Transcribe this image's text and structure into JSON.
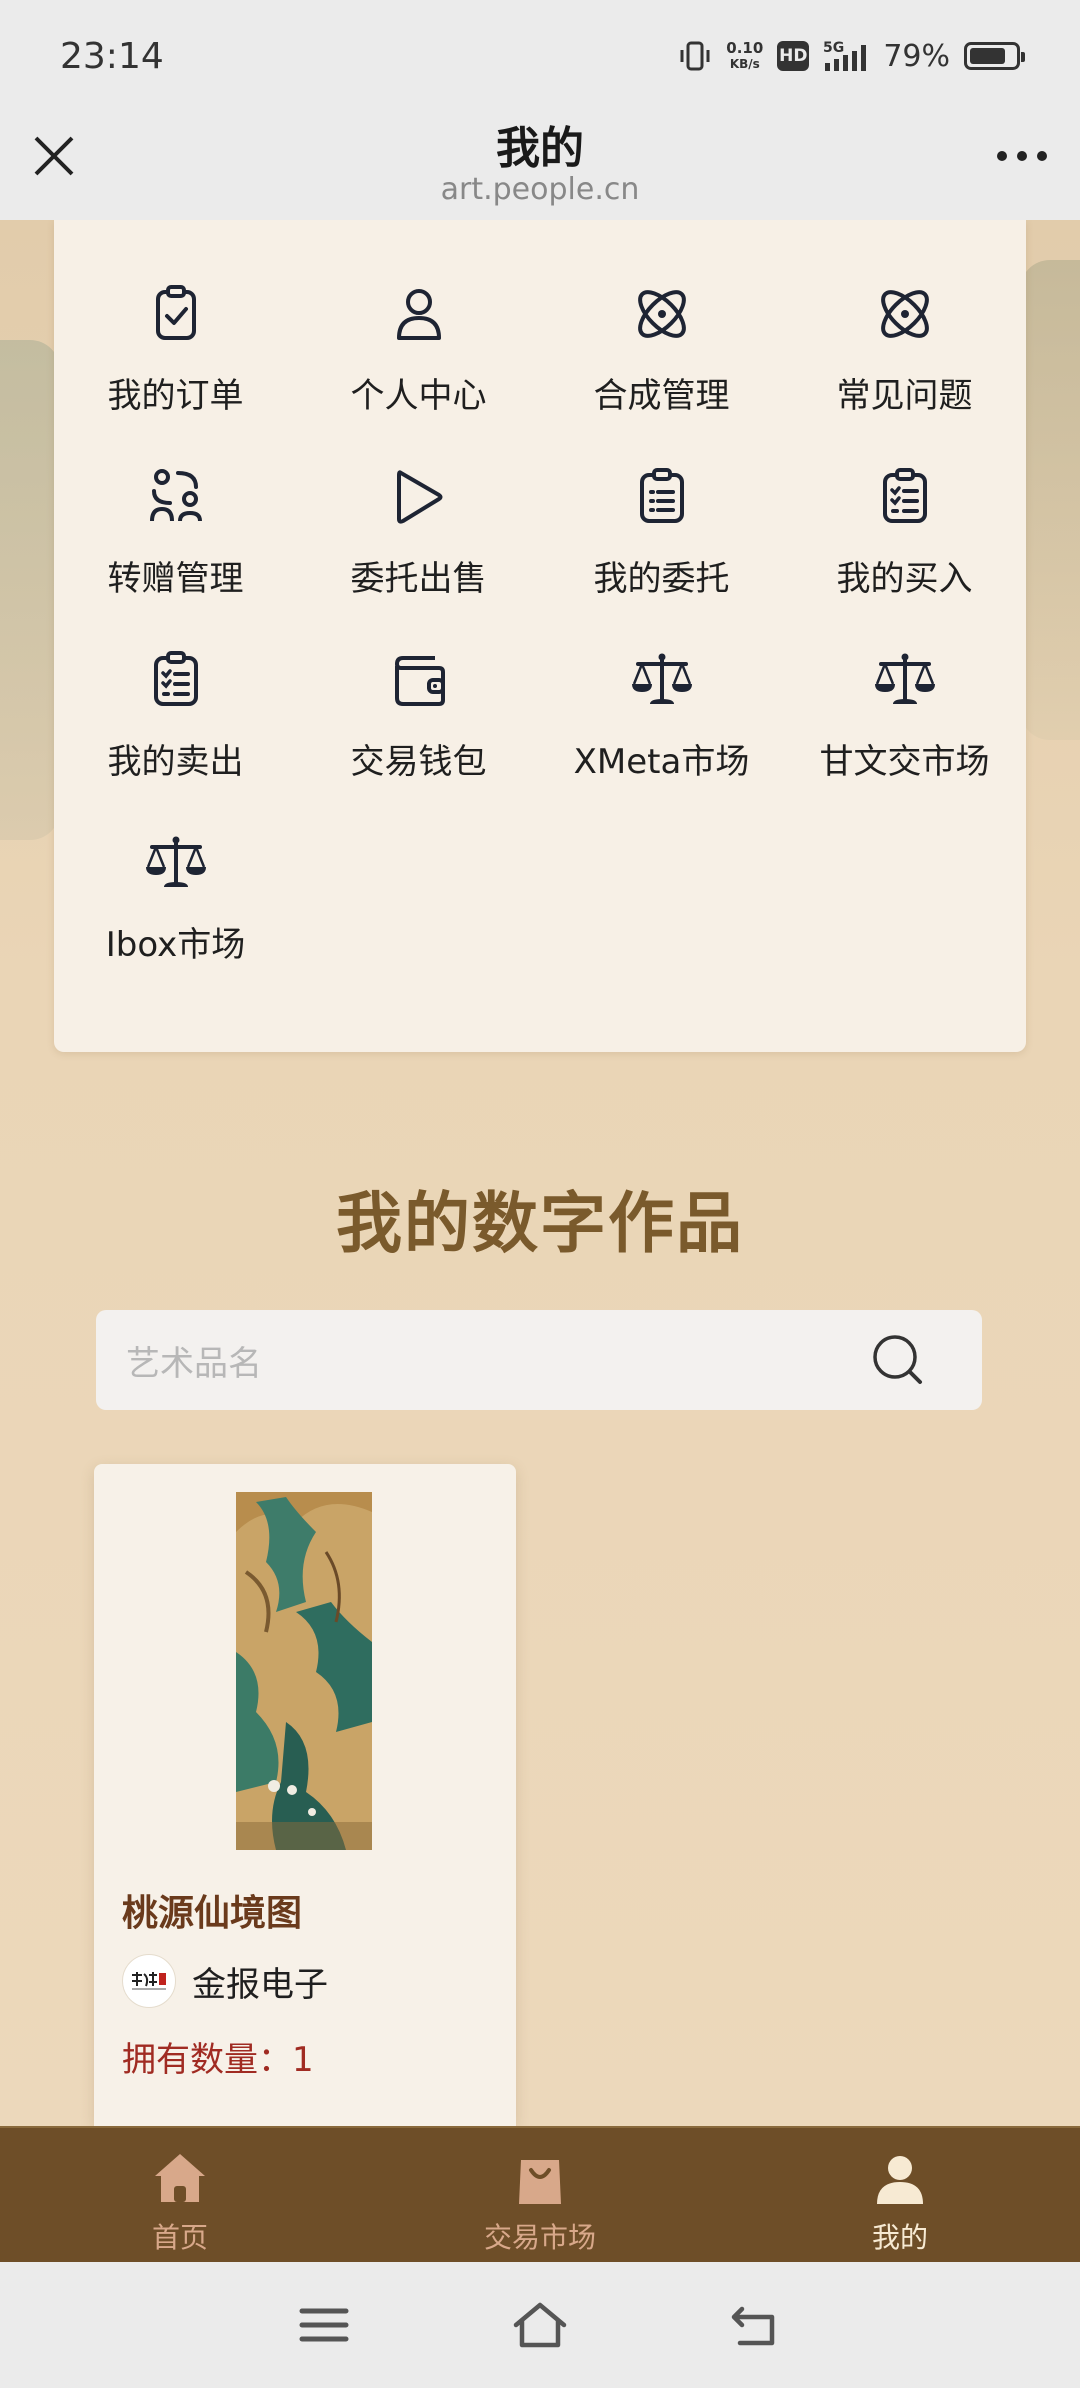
{
  "status_bar": {
    "time": "23:14",
    "net_speed_value": "0.10",
    "net_speed_unit": "KB/s",
    "hd_label": "HD",
    "network": "5G",
    "battery_percent": "79%",
    "battery_level": 0.79
  },
  "title_bar": {
    "title": "我的",
    "url": "art.people.cn",
    "close_icon": "close-icon",
    "more_icon": "more-icon"
  },
  "menu": {
    "items": [
      {
        "label": "我的订单",
        "icon": "clipboard-check-icon"
      },
      {
        "label": "个人中心",
        "icon": "user-icon"
      },
      {
        "label": "合成管理",
        "icon": "atom-icon"
      },
      {
        "label": "常见问题",
        "icon": "atom-icon"
      },
      {
        "label": "转赠管理",
        "icon": "users-transfer-icon"
      },
      {
        "label": "委托出售",
        "icon": "play-icon"
      },
      {
        "label": "我的委托",
        "icon": "clipboard-list-icon"
      },
      {
        "label": "我的买入",
        "icon": "clipboard-checklist-icon"
      },
      {
        "label": "我的卖出",
        "icon": "clipboard-checklist-icon"
      },
      {
        "label": "交易钱包",
        "icon": "wallet-icon"
      },
      {
        "label": "XMeta市场",
        "icon": "scale-icon"
      },
      {
        "label": "甘文交市场",
        "icon": "scale-icon"
      },
      {
        "label": "Ibox市场",
        "icon": "scale-icon"
      }
    ]
  },
  "main": {
    "section_title": "我的数字作品",
    "search": {
      "placeholder": "艺术品名"
    }
  },
  "artwork": {
    "title": "桃源仙境图",
    "publisher": "金报电子",
    "owned_label": "拥有数量：",
    "owned_count": "1"
  },
  "tabbar": {
    "tabs": [
      {
        "label": "首页",
        "icon": "home-icon",
        "active": false
      },
      {
        "label": "交易市场",
        "icon": "shopping-bag-icon",
        "active": false
      },
      {
        "label": "我的",
        "icon": "user-icon",
        "active": true
      }
    ]
  },
  "colors": {
    "accent_brown": "#7a5a2c",
    "tabbar_bg": "#6e4e28",
    "owned_red": "#a02b22",
    "card_bg": "#f7f0e6"
  }
}
